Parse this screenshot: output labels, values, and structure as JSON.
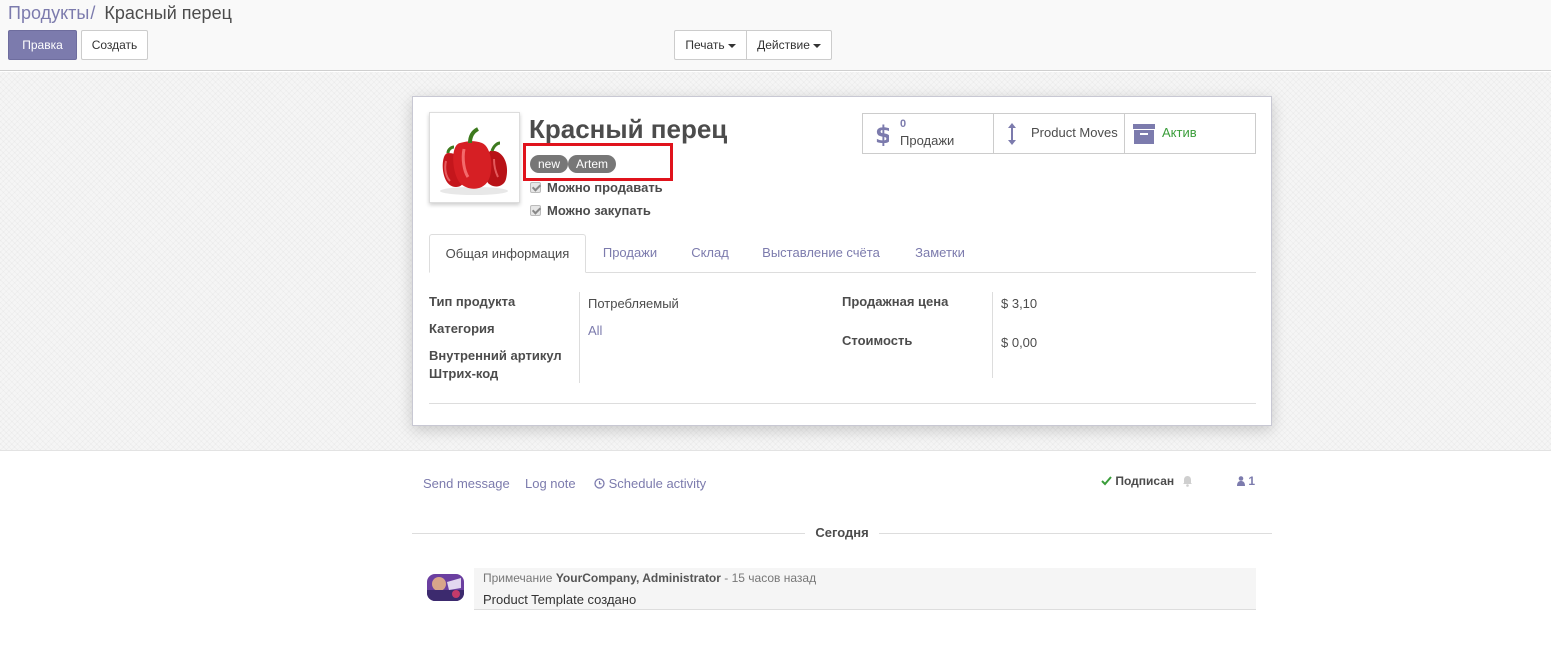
{
  "breadcrumb": {
    "parent": "Продукты",
    "separator": "/",
    "current": "Красный перец"
  },
  "buttons": {
    "edit": "Правка",
    "create": "Создать",
    "print": "Печать",
    "action": "Действие"
  },
  "product": {
    "name": "Красный перец",
    "tags": [
      "new",
      "Artem"
    ],
    "sale_ok": "Можно продавать",
    "purchase_ok": "Можно закупать",
    "image_icon": "red-pepper-image"
  },
  "smart_buttons": {
    "sales": {
      "count": "0",
      "label": "Продажи",
      "icon": "dollar-icon"
    },
    "moves": {
      "label": "Product Moves",
      "icon": "vertical-arrows-icon"
    },
    "active": {
      "label": "Актив",
      "icon": "archive-box-icon"
    }
  },
  "tabs": [
    "Общая информация",
    "Продажи",
    "Склад",
    "Выставление счёта",
    "Заметки"
  ],
  "fields": {
    "type": {
      "label": "Тип продукта",
      "value": "Потребляемый"
    },
    "category": {
      "label": "Категория",
      "value": "All"
    },
    "internal_ref": {
      "label": "Внутренний артикул"
    },
    "barcode": {
      "label": "Штрих-код"
    },
    "list_price": {
      "label": "Продажная цена",
      "value": "$ 3,10"
    },
    "cost": {
      "label": "Стоимость",
      "value": "$ 0,00"
    }
  },
  "chatter": {
    "send_message": "Send message",
    "log_note": "Log note",
    "schedule_activity": "Schedule activity",
    "following": "Подписан",
    "followers_count": "1",
    "date_separator": "Сегодня",
    "message": {
      "type": "Примечание",
      "author": "YourCompany, Administrator",
      "time": "- 15 часов назад",
      "body": "Product Template создано"
    }
  },
  "colors": {
    "primary": "#7c7bad",
    "highlight": "#e0131c",
    "tag": "#777777",
    "active": "#3a9d3a"
  }
}
